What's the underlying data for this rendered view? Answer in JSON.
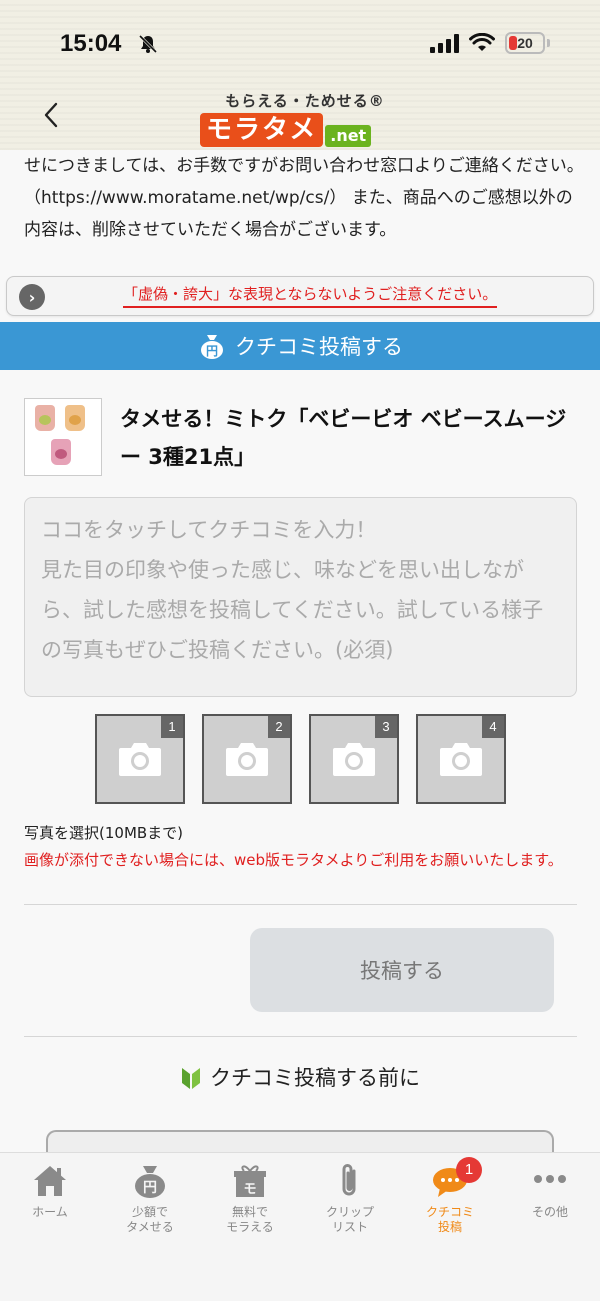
{
  "status_bar": {
    "time": "15:04",
    "battery": "20"
  },
  "header": {
    "logo_tagline": "もらえる・ためせる®",
    "logo_main": "モラタメ",
    "logo_net": ".net"
  },
  "notice": {
    "text": "せにつきましては、お手数ですがお問い合わせ窓口よりご連絡ください。（https://www.moratame.net/wp/cs/） また、商品へのご感想以外の内容は、削除させていただく場合がございます。"
  },
  "caution": {
    "text": "「虚偽・誇大」な表現とならないようご注意ください。"
  },
  "post_banner": {
    "label": "クチコミ投稿する"
  },
  "product": {
    "title": "タメせる！ミトク「ベビービオ ベビースムージー 3種21点」"
  },
  "review_input": {
    "placeholder": "ココをタッチしてクチコミを入力！\n見た目の印象や使った感じ、味などを思い出しながら、試した感想を投稿してください。試している様子の写真もぜひご投稿ください。(必須)"
  },
  "photos": {
    "slots": [
      "1",
      "2",
      "3",
      "4"
    ],
    "select_label": "写真を選択(10MBまで)",
    "warning": "画像が添付できない場合には、web版モラタメよりご利用をお願いいたします。"
  },
  "submit": {
    "label": "投稿する"
  },
  "before_post": {
    "label": "クチコミ投稿する前に"
  },
  "tabbar": {
    "tabs": [
      {
        "label": "ホーム",
        "icon": "home-icon"
      },
      {
        "label": "少額で\nタメせる",
        "icon": "coin-bag-icon"
      },
      {
        "label": "無料で\nモラえる",
        "icon": "gift-icon"
      },
      {
        "label": "クリップ\nリスト",
        "icon": "paperclip-icon"
      },
      {
        "label": "クチコミ\n投稿",
        "icon": "speech-bubble-icon",
        "badge": "1",
        "active": true
      },
      {
        "label": "その他",
        "icon": "more-dots-icon"
      }
    ]
  },
  "colors": {
    "banner_blue": "#3a97d4",
    "warning_red": "#e02020",
    "active_orange": "#f08a18",
    "logo_orange": "#e94f1a",
    "logo_green": "#6bb31f"
  }
}
